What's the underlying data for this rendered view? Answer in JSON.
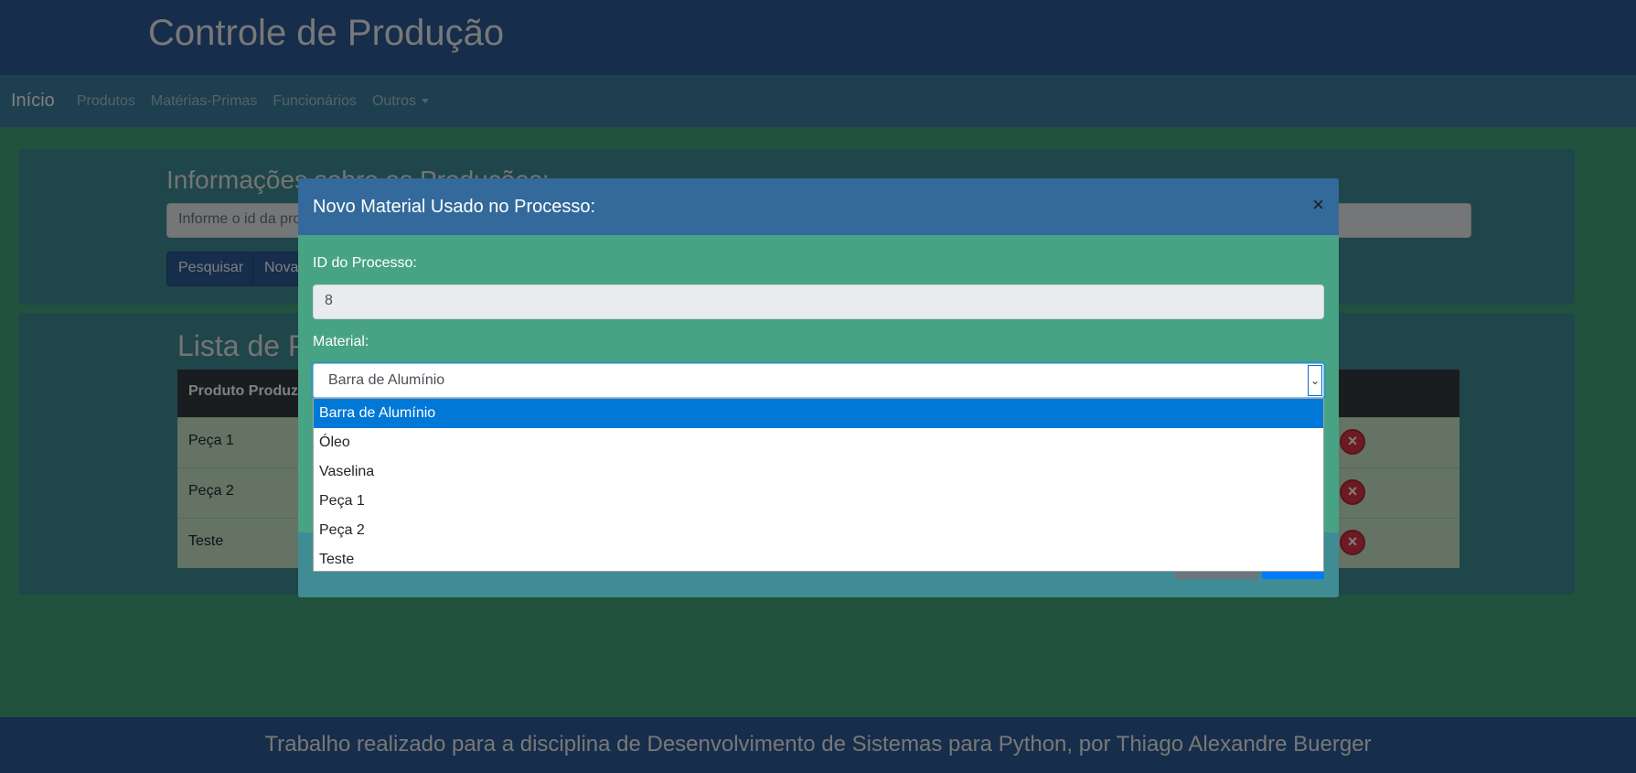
{
  "app_title": "Controle de Produção",
  "navbar": {
    "brand": "Início",
    "items": [
      {
        "label": "Produtos"
      },
      {
        "label": "Matérias-Primas"
      },
      {
        "label": "Funcionários"
      },
      {
        "label": "Outros"
      }
    ]
  },
  "search_card": {
    "title": "Informações sobre as Produções:",
    "placeholder": "Informe o id da produção",
    "search_button": "Pesquisar",
    "new_button": "Nova"
  },
  "list_card": {
    "title": "Lista de Produções",
    "column_header": "Produto Produzido",
    "rows": [
      {
        "product": "Peça 1"
      },
      {
        "product": "Peça 2"
      },
      {
        "product": "Teste"
      }
    ]
  },
  "modal": {
    "title": "Novo Material Usado no Processo:",
    "close_symbol": "×",
    "process_id_label": "ID do Processo:",
    "process_id_value": "8",
    "material_label": "Material:",
    "material_selected": "Barra de Alumínio",
    "options": [
      {
        "label": "Barra de Alumínio",
        "selected": true
      },
      {
        "label": "Óleo",
        "selected": false
      },
      {
        "label": "Vaselina",
        "selected": false
      },
      {
        "label": "Peça 1",
        "selected": false
      },
      {
        "label": "Peça 2",
        "selected": false
      },
      {
        "label": "Teste",
        "selected": false
      }
    ]
  },
  "footer": {
    "text": "Trabalho realizado para a disciplina de Desenvolvimento de Sistemas para Python, por Thiago Alexandre Buerger"
  },
  "icons": {
    "delete": "close-circle-icon",
    "edit": "pencil-icon",
    "dropdown_arrow": "chevron-down-icon"
  },
  "colors": {
    "header": "#2c5a96",
    "navbar": "#3b7f9e",
    "body": "#43a47b",
    "modal_header": "#33699b",
    "modal_body": "#48a385",
    "option_highlight": "#0078d7"
  }
}
